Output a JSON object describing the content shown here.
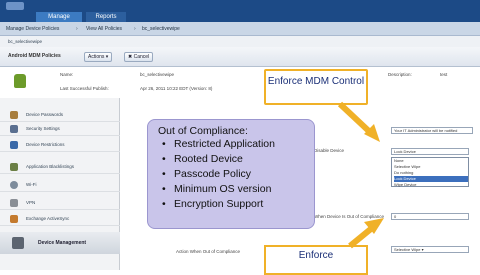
{
  "topnav": {
    "tabs": [
      "Manage",
      "Reports"
    ]
  },
  "toolbar1": {
    "policies": "Manage Device Policies",
    "view_all": "View All Policies",
    "current": "bc_selectivewipe"
  },
  "breadcrumb": "bc_selectivewipe",
  "policy_header": {
    "title": "Android MDM Policies",
    "actions": "Actions",
    "cancel": "Cancel"
  },
  "details": {
    "name_label": "Name:",
    "name_value": "bc_selectivewipe",
    "published_label": "Last Successful Publish:",
    "published_value": "Apr 26, 2011 10:22 EDT (Version: 8)",
    "description_label": "Description:",
    "description_value": "test"
  },
  "sidebar": {
    "items": [
      "Device Passwords",
      "Security Settings",
      "Device Restrictions",
      "Application Blacklistings",
      "Wi-Fi",
      "VPN",
      "Exchange ActiveSync"
    ],
    "device_management": "Device Management"
  },
  "form": {
    "admin_field": "Your IT Administrator will be notified",
    "row_label_1": "Disable Device",
    "compliance_label": "When Device Is Out of Compliance",
    "compliance_value": "0",
    "action_label": "Action When Out of Compliance",
    "action_value": "Selective Wipe",
    "dropdown": {
      "selected": "Lock Device",
      "options": [
        "None",
        "Selective Wipe",
        "Do nothing",
        "Lock Device",
        "Wipe Device"
      ]
    }
  },
  "callouts": {
    "enforce_mdm": "Enforce MDM Control",
    "enforce": "Enforce"
  },
  "compliance_box": {
    "title": "Out of Compliance:",
    "items": [
      "Restricted Application",
      "Rooted Device",
      "Passcode Policy",
      "Minimum OS version",
      "Encryption Support"
    ]
  },
  "colors": {
    "nav": "#1c4a86",
    "callout_border": "#f0b128",
    "callout_text": "#1a2f77",
    "compliance_bg": "#c9c5ea"
  }
}
